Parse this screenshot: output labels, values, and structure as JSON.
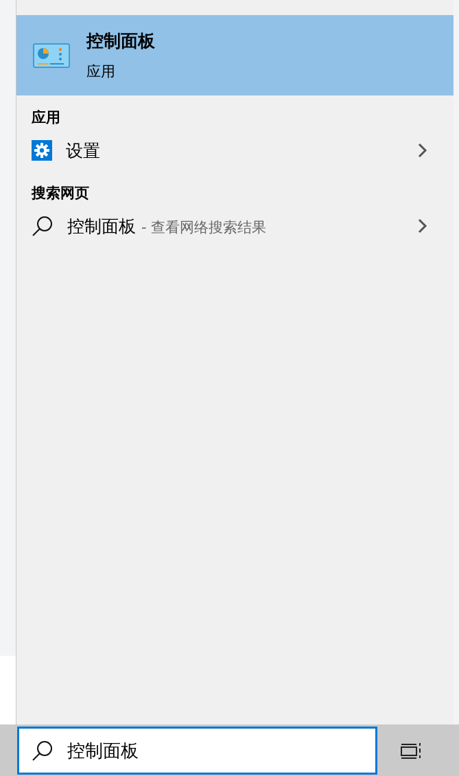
{
  "best_match": {
    "title": "控制面板",
    "subtitle": "应用",
    "selected": true
  },
  "sections": [
    {
      "heading": "应用",
      "items": [
        {
          "kind": "app",
          "label": "设置"
        }
      ]
    },
    {
      "heading": "搜索网页",
      "items": [
        {
          "kind": "web",
          "label": "控制面板",
          "hint": " - 查看网络搜索结果"
        }
      ]
    }
  ],
  "search": {
    "value": "控制面板"
  }
}
